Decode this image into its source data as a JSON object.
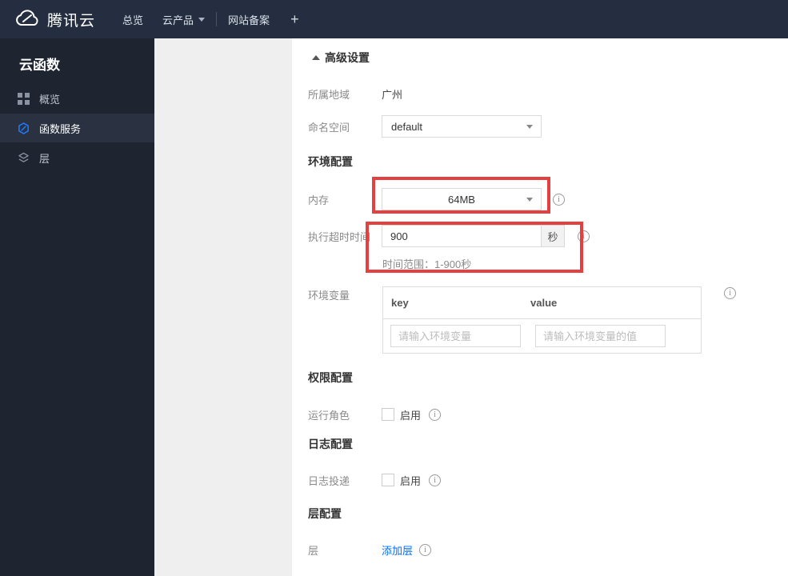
{
  "topbar": {
    "brand": "腾讯云",
    "nav": [
      {
        "label": "总览"
      },
      {
        "label": "云产品",
        "has_chevron": true
      },
      {
        "label": "网站备案"
      },
      {
        "label": "+"
      }
    ]
  },
  "sidebar": {
    "title": "云函数",
    "items": [
      {
        "label": "概览",
        "icon": "grid-icon",
        "active": false
      },
      {
        "label": "函数服务",
        "icon": "function-hexagon-icon",
        "active": true
      },
      {
        "label": "层",
        "icon": "layers-icon",
        "active": false
      }
    ]
  },
  "main": {
    "advanced_toggle": "高级设置",
    "region_label": "所属地域",
    "region_value": "广州",
    "namespace_label": "命名空间",
    "namespace_value": "default",
    "env_section": "环境配置",
    "memory_label": "内存",
    "memory_value": "64MB",
    "timeout_label": "执行超时时间",
    "timeout_value": "900",
    "timeout_unit": "秒",
    "timeout_hint": "时间范围：1-900秒",
    "envvar_label": "环境变量",
    "envvar_key_header": "key",
    "envvar_value_header": "value",
    "envvar_key_placeholder": "请输入环境变量",
    "envvar_value_placeholder": "请输入环境变量的值",
    "perm_section": "权限配置",
    "role_label": "运行角色",
    "role_enable_label": "启用",
    "log_section": "日志配置",
    "log_label": "日志投递",
    "log_enable_label": "启用",
    "layer_section": "层配置",
    "layer_label": "层",
    "add_layer_link": "添加层"
  },
  "icons": {
    "info": "i"
  },
  "colors": {
    "accent_blue": "#006eff",
    "highlight_red": "#e54040",
    "topbar_bg": "#242e40",
    "sidebar_bg": "#1e2430",
    "sidebar_active_bg": "#2a3242",
    "panel_gray": "#efefef"
  }
}
